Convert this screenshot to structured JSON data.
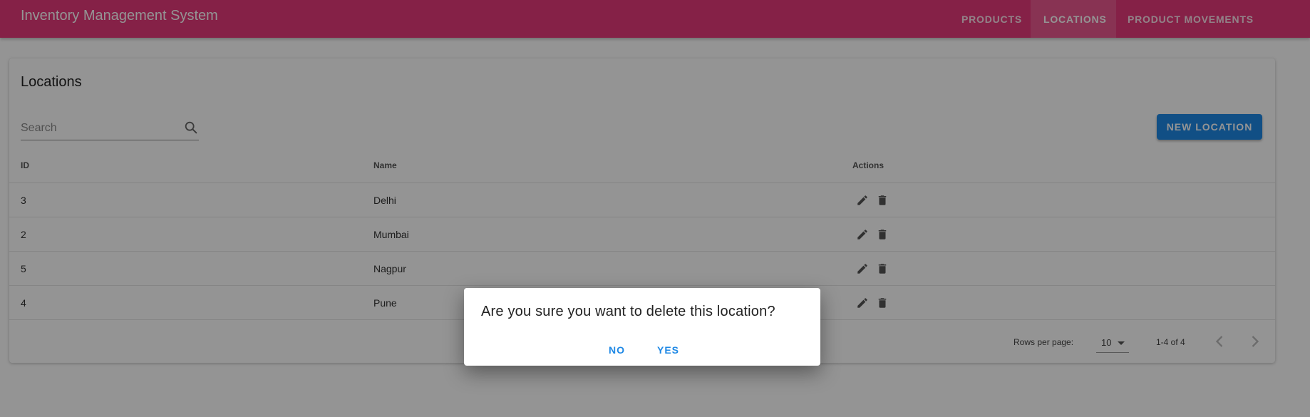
{
  "app": {
    "title": "Inventory Management System"
  },
  "nav": {
    "tabs": [
      {
        "label": "PRODUCTS",
        "active": false
      },
      {
        "label": "LOCATIONS",
        "active": true
      },
      {
        "label": "PRODUCT MOVEMENTS",
        "active": false
      }
    ]
  },
  "page": {
    "title": "Locations",
    "search": {
      "placeholder": "Search",
      "value": "",
      "icon": "search-icon"
    },
    "new_button": "NEW LOCATION"
  },
  "table": {
    "columns": [
      "ID",
      "Name",
      "Actions"
    ],
    "rows": [
      {
        "id": "3",
        "name": "Delhi"
      },
      {
        "id": "2",
        "name": "Mumbai"
      },
      {
        "id": "5",
        "name": "Nagpur"
      },
      {
        "id": "4",
        "name": "Pune"
      }
    ],
    "action_icons": [
      "pencil-icon",
      "trash-icon"
    ]
  },
  "pagination": {
    "rows_per_page_label": "Rows per page:",
    "rows_per_page_value": "10",
    "range": "1-4 of 4"
  },
  "dialog": {
    "message": "Are you sure you want to delete this location?",
    "no_label": "NO",
    "yes_label": "YES"
  },
  "colors": {
    "appbar": "#e63a7a",
    "primary": "#1e88e5",
    "backdrop": "rgba(0,0,0,0.42)"
  }
}
